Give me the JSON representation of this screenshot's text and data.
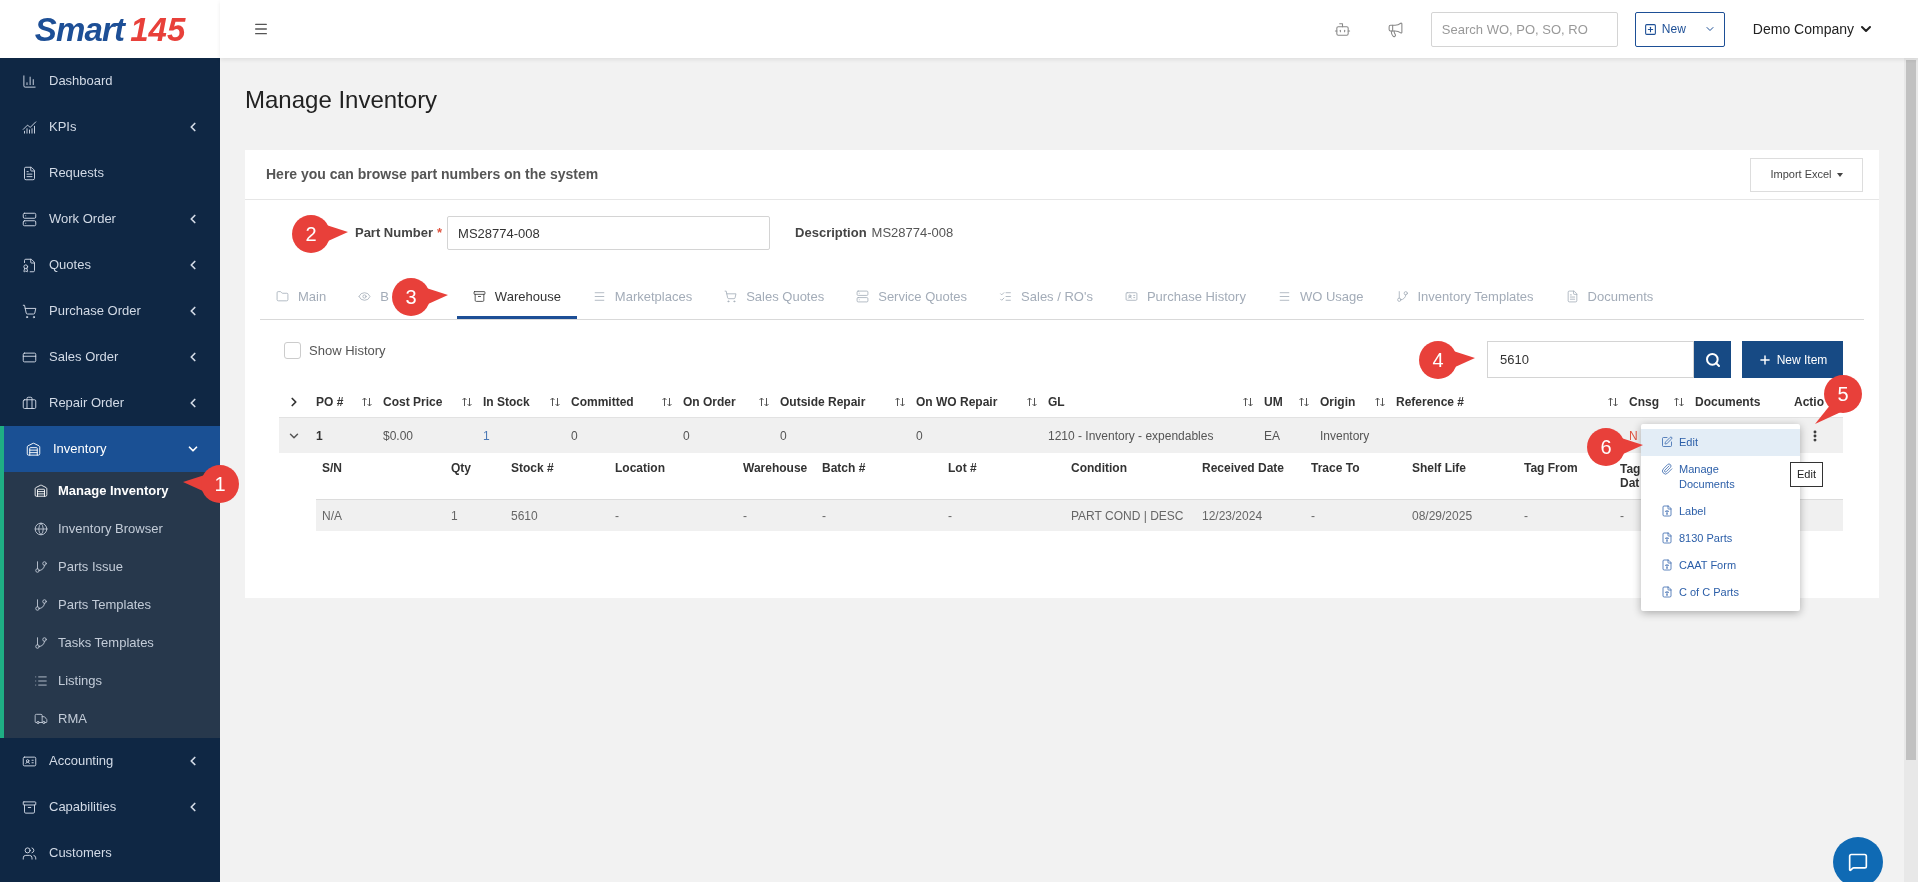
{
  "logo": {
    "word": "Smart",
    "mark": "145"
  },
  "sidebar": {
    "items": [
      {
        "label": "Dashboard",
        "selected": false
      },
      {
        "label": "KPIs",
        "selected": false,
        "expanded": false
      },
      {
        "label": "Requests",
        "selected": false
      },
      {
        "label": "Work Order",
        "selected": false,
        "expanded": false
      },
      {
        "label": "Quotes",
        "selected": false,
        "expanded": false
      },
      {
        "label": "Purchase Order",
        "selected": false,
        "expanded": false
      },
      {
        "label": "Sales Order",
        "selected": false,
        "expanded": false
      },
      {
        "label": "Repair Order",
        "selected": false,
        "expanded": false
      },
      {
        "label": "Inventory",
        "selected": true,
        "expanded": true,
        "children": [
          {
            "label": "Manage Inventory",
            "selected": true
          },
          {
            "label": "Inventory Browser",
            "selected": false
          },
          {
            "label": "Parts Issue",
            "selected": false
          },
          {
            "label": "Parts Templates",
            "selected": false
          },
          {
            "label": "Tasks Templates",
            "selected": false
          },
          {
            "label": "Listings",
            "selected": false
          },
          {
            "label": "RMA",
            "selected": false
          }
        ]
      },
      {
        "label": "Accounting",
        "selected": false,
        "expanded": false
      },
      {
        "label": "Capabilities",
        "selected": false,
        "expanded": false
      },
      {
        "label": "Customers",
        "selected": false
      }
    ]
  },
  "topbar": {
    "search": {
      "placeholder": "Search WO, PO, SO, RO"
    },
    "new_button": "New",
    "company": "Demo Company"
  },
  "page_title": "Manage Inventory",
  "card": {
    "intro": "Here you can browse part numbers on the system",
    "import_button": "Import Excel",
    "part_number": {
      "label": "Part Number",
      "required_mark": "*",
      "value": "MS28774-008"
    },
    "description": {
      "label": "Description",
      "value": "MS28774-008"
    },
    "tabs": [
      {
        "label": "Main",
        "selected": false
      },
      {
        "label": "B",
        "selected": false
      },
      {
        "label": "Warehouse",
        "selected": true
      },
      {
        "label": "Marketplaces",
        "selected": false
      },
      {
        "label": "Sales Quotes",
        "selected": false
      },
      {
        "label": "Service Quotes",
        "selected": false
      },
      {
        "label": "Sales / RO's",
        "selected": false
      },
      {
        "label": "Purchase History",
        "selected": false
      },
      {
        "label": "WO Usage",
        "selected": false
      },
      {
        "label": "Inventory Templates",
        "selected": false
      },
      {
        "label": "Documents",
        "selected": false
      }
    ],
    "show_history": {
      "label": "Show History",
      "checked": false
    },
    "search": {
      "value": "5610"
    },
    "new_item_button": "New Item"
  },
  "table": {
    "columns": [
      {
        "label": "PO #",
        "sortable": true
      },
      {
        "label": "Cost Price",
        "sortable": true
      },
      {
        "label": "In Stock",
        "sortable": true
      },
      {
        "label": "Committed",
        "sortable": true
      },
      {
        "label": "On Order",
        "sortable": true
      },
      {
        "label": "Outside Repair",
        "sortable": true
      },
      {
        "label": "On WO Repair",
        "sortable": true
      },
      {
        "label": "GL",
        "sortable": true
      },
      {
        "label": "UM",
        "sortable": true
      },
      {
        "label": "Origin",
        "sortable": true
      },
      {
        "label": "Reference #",
        "sortable": true
      },
      {
        "label": "Cnsg",
        "sortable": true
      },
      {
        "label": "Documents",
        "sortable": false
      },
      {
        "label": "Actio",
        "sortable": false
      }
    ],
    "rows": [
      {
        "expanded": true,
        "po": "1",
        "cost_price": "$0.00",
        "in_stock": "1",
        "committed": "0",
        "on_order": "0",
        "outside_repair": "0",
        "on_wo_repair": "0",
        "gl": "1210 - Inventory - expendables",
        "um": "EA",
        "origin": "Inventory",
        "cnsg": "N",
        "detail": {
          "columns": [
            "S/N",
            "Qty",
            "Stock #",
            "Location",
            "Warehouse",
            "Batch #",
            "Lot #",
            "Condition",
            "Received Date",
            "Trace To",
            "Shelf Life",
            "Tag From",
            "Tag Dat"
          ],
          "rows": [
            [
              "N/A",
              "1",
              "5610",
              "-",
              "-",
              "-",
              "-",
              "PART COND | DESC",
              "12/23/2024",
              "-",
              "08/29/2025",
              "-",
              "-"
            ]
          ]
        }
      }
    ]
  },
  "action_menu": {
    "items": [
      {
        "label": "Edit",
        "selected": true
      },
      {
        "label": "Manage Documents",
        "selected": false
      },
      {
        "label": "Label",
        "selected": false
      },
      {
        "label": "8130 Parts",
        "selected": false
      },
      {
        "label": "CAAT Form",
        "selected": false
      },
      {
        "label": "C of C Parts",
        "selected": false
      }
    ],
    "tooltip": "Edit"
  },
  "callouts": [
    "1",
    "2",
    "3",
    "4",
    "5",
    "6"
  ]
}
